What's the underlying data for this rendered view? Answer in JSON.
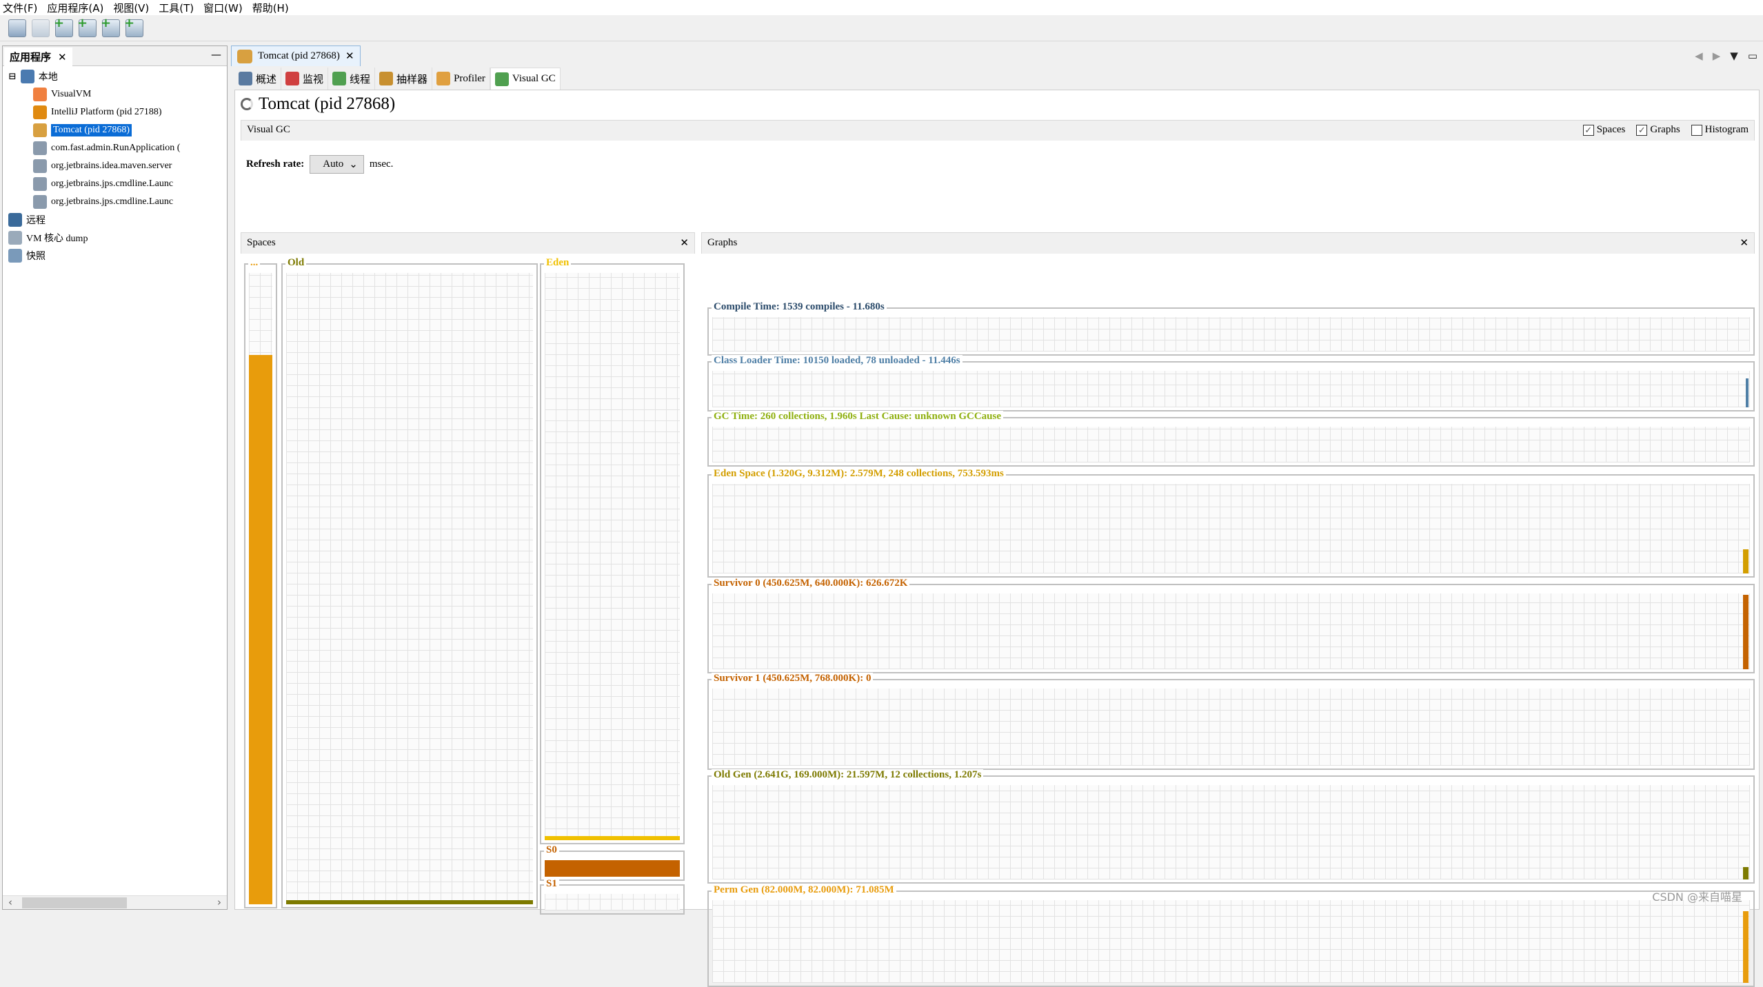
{
  "menu": [
    "文件(F)",
    "应用程序(A)",
    "视图(V)",
    "工具(T)",
    "窗口(W)",
    "帮助(H)"
  ],
  "left_panel": {
    "tab": "应用程序",
    "close": "✕",
    "minimize": "—",
    "tree": [
      {
        "label": "本地",
        "level": 0,
        "icon": "computer-icon"
      },
      {
        "label": "VisualVM",
        "level": 1,
        "icon": "visualvm-icon"
      },
      {
        "label": "IntelliJ Platform (pid 27188)",
        "level": 1,
        "icon": "intellij-icon"
      },
      {
        "label": "Tomcat (pid 27868)",
        "level": 1,
        "icon": "tomcat-icon",
        "selected": true
      },
      {
        "label": "com.fast.admin.RunApplication (",
        "level": 1,
        "icon": "java-icon"
      },
      {
        "label": "org.jetbrains.idea.maven.server",
        "level": 1,
        "icon": "java-icon"
      },
      {
        "label": "org.jetbrains.jps.cmdline.Launc",
        "level": 1,
        "icon": "java-icon"
      },
      {
        "label": "org.jetbrains.jps.cmdline.Launc",
        "level": 1,
        "icon": "java-icon"
      },
      {
        "label": "远程",
        "level": 0,
        "icon": "remote-icon"
      },
      {
        "label": "VM 核心 dump",
        "level": 0,
        "icon": "core-dump-icon"
      },
      {
        "label": "快照",
        "level": 0,
        "icon": "snapshot-icon"
      }
    ]
  },
  "doc_tab": {
    "label": "Tomcat (pid 27868)",
    "close": "✕"
  },
  "subtabs": [
    {
      "label": "概述",
      "icon": "overview-icon"
    },
    {
      "label": "监视",
      "icon": "monitor-icon"
    },
    {
      "label": "线程",
      "icon": "threads-icon"
    },
    {
      "label": "抽样器",
      "icon": "sampler-icon"
    },
    {
      "label": "Profiler",
      "icon": "profiler-icon"
    },
    {
      "label": "Visual GC",
      "icon": "visualgc-icon",
      "active": true
    }
  ],
  "page_title": "Tomcat (pid 27868)",
  "visual_gc_bar": {
    "title": "Visual GC",
    "checks": [
      {
        "label": "Spaces",
        "checked": true
      },
      {
        "label": "Graphs",
        "checked": true
      },
      {
        "label": "Histogram",
        "checked": false
      }
    ]
  },
  "refresh": {
    "label": "Refresh rate:",
    "value": "Auto",
    "unit": "msec."
  },
  "spaces": {
    "title": "Spaces",
    "close": "✕"
  },
  "graphs_panel": {
    "title": "Graphs",
    "close": "✕"
  },
  "watermark": "CSDN @来自喵星",
  "chart_data": [
    {
      "type": "bar",
      "title": "Spaces",
      "categories": [
        "...",
        "Old",
        "Eden",
        "S0",
        "S1"
      ],
      "values": [
        0.87,
        0.02,
        0.005,
        0.98,
        0
      ],
      "colors": [
        "#E89C0C",
        "#7D7A00",
        "#F0C000",
        "#C46200",
        "#C46200"
      ]
    },
    {
      "type": "area",
      "series": [
        {
          "name": "Compile Time: 1539 compiles - 11.680s",
          "color": "#2A4A6A",
          "last": 0
        },
        {
          "name": "Class Loader Time: 10150 loaded, 78 unloaded - 11.446s",
          "color": "#4F7FA6",
          "last": 0.8
        },
        {
          "name": "GC Time: 260 collections, 1.960s  Last Cause: unknown GCCause",
          "color": "#8FB010",
          "last": 0
        },
        {
          "name": "Eden Space (1.320G, 9.312M): 2.579M, 248 collections, 753.593ms",
          "color": "#D39E00",
          "last": 0.27
        },
        {
          "name": "Survivor 0 (450.625M, 640.000K): 626.672K",
          "color": "#C46200",
          "last": 0.98
        },
        {
          "name": "Survivor 1 (450.625M, 768.000K): 0",
          "color": "#C46200",
          "last": 0
        },
        {
          "name": "Old Gen (2.641G, 169.000M): 21.597M, 12 collections, 1.207s",
          "color": "#7D7A00",
          "last": 0.13
        },
        {
          "name": "Perm Gen (82.000M, 82.000M): 71.085M",
          "color": "#E89C0C",
          "last": 0.87
        }
      ]
    }
  ]
}
